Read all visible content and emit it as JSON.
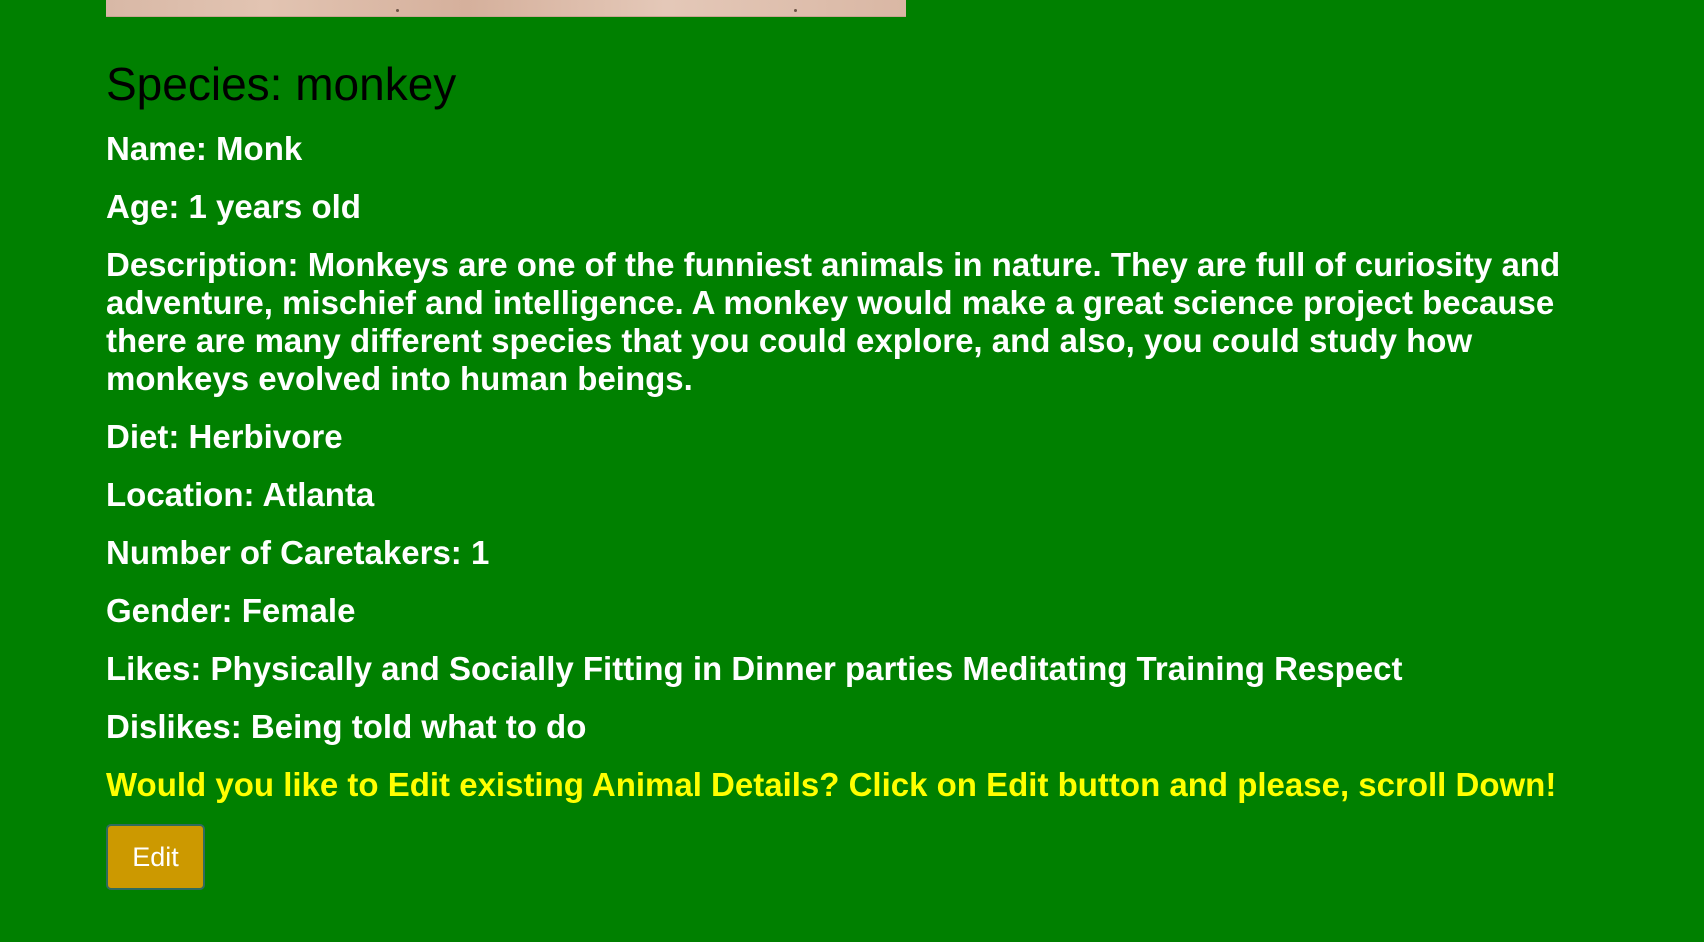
{
  "species": {
    "label": "Species: ",
    "value": "monkey"
  },
  "details": {
    "name_label": "Name: ",
    "name_value": "Monk",
    "age_label": "Age: ",
    "age_value": "1 years old",
    "description_label": "Description: ",
    "description_value": "Monkeys are one of the funniest animals in nature. They are full of curiosity and adventure, mischief and intelligence. A monkey would make a great science project because there are many different species that you could explore, and also, you could study how monkeys evolved into human beings.",
    "diet_label": "Diet: ",
    "diet_value": "Herbivore",
    "location_label": "Location: ",
    "location_value": "Atlanta",
    "caretakers_label": "Number of Caretakers: ",
    "caretakers_value": "1",
    "gender_label": "Gender: ",
    "gender_value": "Female",
    "likes_label": "Likes: ",
    "likes_value": "Physically and Socially Fitting in Dinner parties Meditating Training Respect",
    "dislikes_label": "Dislikes: ",
    "dislikes_value": "Being told what to do"
  },
  "edit_prompt": "Would you like to Edit existing Animal Details? Click on Edit button and please, scroll Down!",
  "edit_button_label": "Edit",
  "colors": {
    "background": "#008000",
    "prompt_text": "#ffff00",
    "edit_button": "#cc9900"
  }
}
